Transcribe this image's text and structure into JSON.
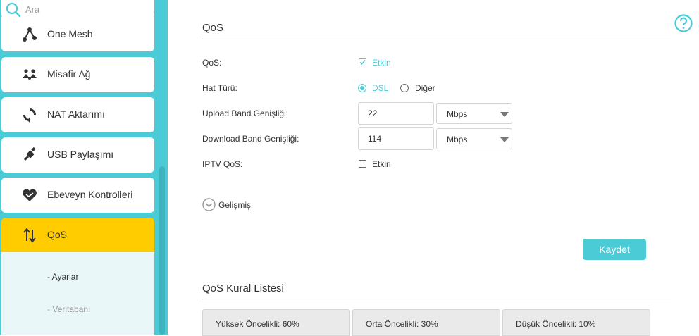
{
  "search": {
    "placeholder": "Ara"
  },
  "sidebar": {
    "items": [
      {
        "label": "One Mesh",
        "icon": "mesh-icon"
      },
      {
        "label": "Misafir Ağ",
        "icon": "guest-network-icon"
      },
      {
        "label": "NAT Aktarımı",
        "icon": "nat-forwarding-icon"
      },
      {
        "label": "USB Paylaşımı",
        "icon": "usb-icon"
      },
      {
        "label": "Ebeveyn Kontrolleri",
        "icon": "parental-controls-icon"
      },
      {
        "label": "QoS",
        "icon": "qos-icon",
        "active": true
      }
    ],
    "subitems": [
      {
        "label": "- Ayarlar",
        "active": true
      },
      {
        "label": "- Veritabanı",
        "active": false
      }
    ]
  },
  "main": {
    "title": "QoS",
    "qos_label": "QoS:",
    "qos_enable": "Etkin",
    "line_type_label": "Hat Türü:",
    "line_type_options": [
      "DSL",
      "Diğer"
    ],
    "upload_label": "Upload Band Genişliği:",
    "upload_value": "22",
    "upload_unit": "Mbps",
    "download_label": "Download Band Genişliği:",
    "download_value": "114",
    "download_unit": "Mbps",
    "iptv_label": "IPTV QoS:",
    "iptv_enable": "Etkin",
    "advanced": "Gelişmiş",
    "save": "Kaydet"
  },
  "rules": {
    "title": "QoS Kural Listesi",
    "tabs": [
      "Yüksek Öncelikli: 60%",
      "Orta Öncelikli: 30%",
      "Düşük Öncelikli: 10%"
    ]
  },
  "colors": {
    "accent": "#4acbd6",
    "active": "#ffcc00",
    "text": "#333333",
    "sub_active": "#333333",
    "sub_inactive": "#999999"
  }
}
